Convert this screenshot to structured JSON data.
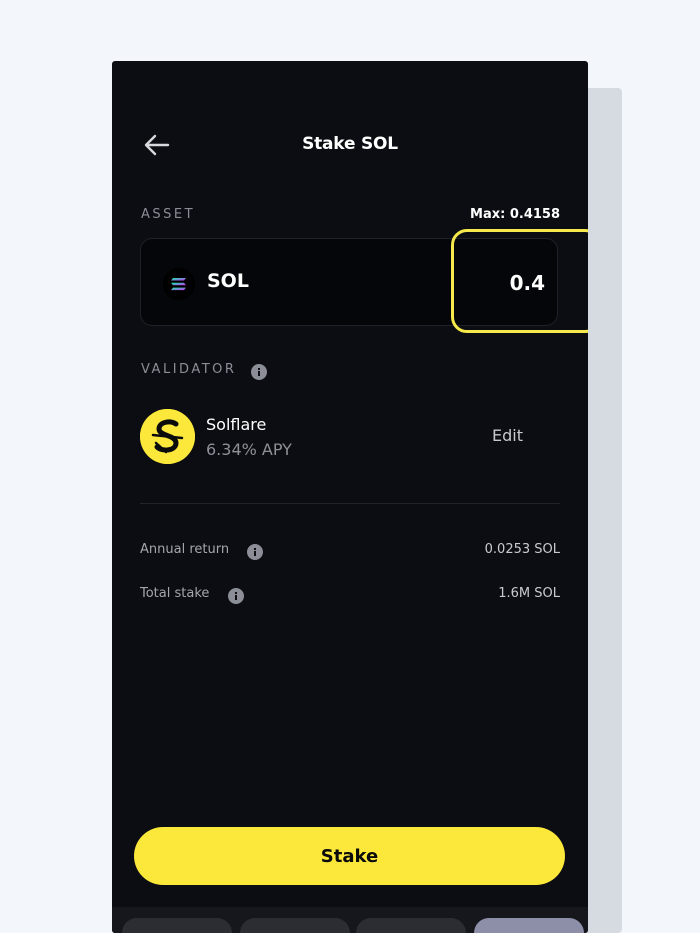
{
  "header": {
    "title": "Stake SOL",
    "back_icon": "arrow-left-icon"
  },
  "asset": {
    "section_label": "ASSET",
    "max_text": "Max: 0.4158",
    "token_symbol": "SOL",
    "token_icon": "solana-logo-icon",
    "amount_value": "0.4"
  },
  "validator": {
    "section_label": "VALIDATOR",
    "info_icon": "info-icon",
    "name": "Solflare",
    "apy": "6.34% APY",
    "logo_icon": "solflare-logo-icon",
    "edit_label": "Edit"
  },
  "details": [
    {
      "label": "Annual return",
      "value": "0.0253 SOL"
    },
    {
      "label": "Total stake",
      "value": "1.6M SOL"
    }
  ],
  "actions": {
    "stake_label": "Stake"
  },
  "colors": {
    "accent": "#fbe83b",
    "background": "#0c0d12",
    "highlight": "#f6e94c"
  }
}
